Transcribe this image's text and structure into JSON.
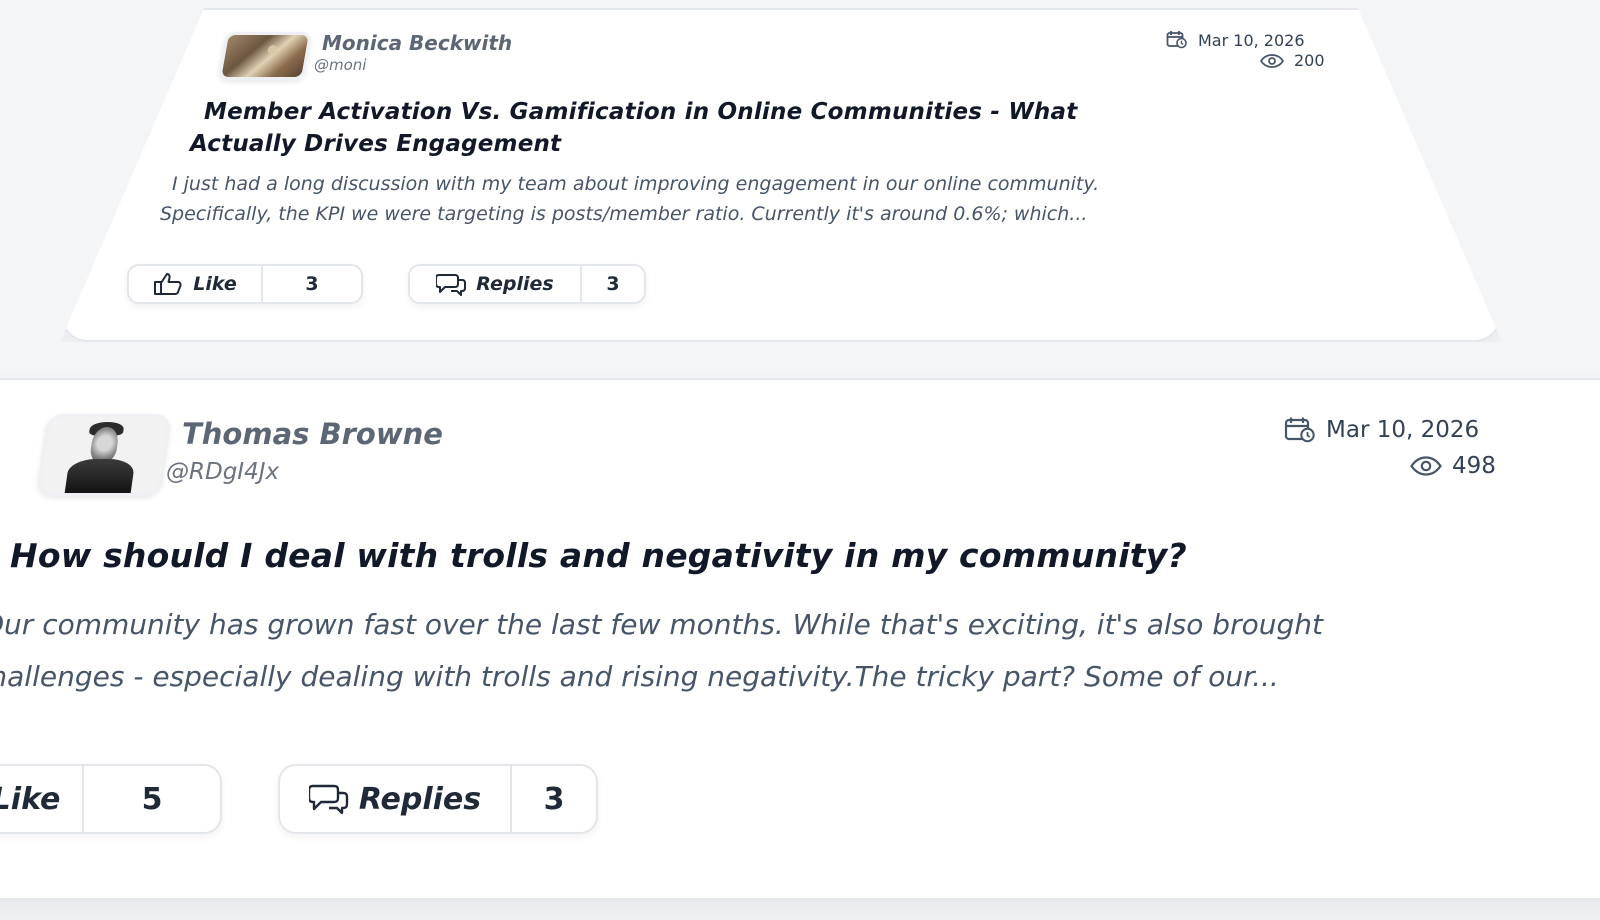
{
  "posts": [
    {
      "author": {
        "name": "Monica Beckwith",
        "handle": "@moni"
      },
      "date": "Mar 10, 2026",
      "views": "200",
      "title_line1": "Member Activation Vs. Gamification in Online Communities - What",
      "title_line2": "Actually Drives Engagement",
      "excerpt_line1": "I just had a long discussion with my team about improving engagement in our online community.",
      "excerpt_line2": "Specifically, the KPI we were targeting is posts/member ratio. Currently it's around 0.6%; which...",
      "like_label": "Like",
      "like_count": "3",
      "replies_label": "Replies",
      "replies_count": "3"
    },
    {
      "author": {
        "name": "Thomas Browne",
        "handle": "@RDgI4Jx"
      },
      "date": "Mar 10, 2026",
      "views": "498",
      "title": "How should I deal with trolls and negativity in my community?",
      "excerpt_line1": "Our community has grown fast over the last few months. While that's exciting, it's also brought",
      "excerpt_line2": "challenges - especially dealing with trolls and rising negativity.The tricky part? Some of our...",
      "like_label": "Like",
      "like_count": "5",
      "replies_label": "Replies",
      "replies_count": "3"
    }
  ],
  "colors": {
    "page_background": "#f4f5f7",
    "card_background": "#ffffff",
    "border": "#e4e7eb",
    "title": "#111827",
    "author_name": "#5d6675",
    "excerpt": "#475569"
  },
  "icons": {
    "date": "calendar-clock-icon",
    "views": "eye-icon",
    "like": "thumbs-up-icon",
    "replies": "chat-bubbles-icon"
  }
}
